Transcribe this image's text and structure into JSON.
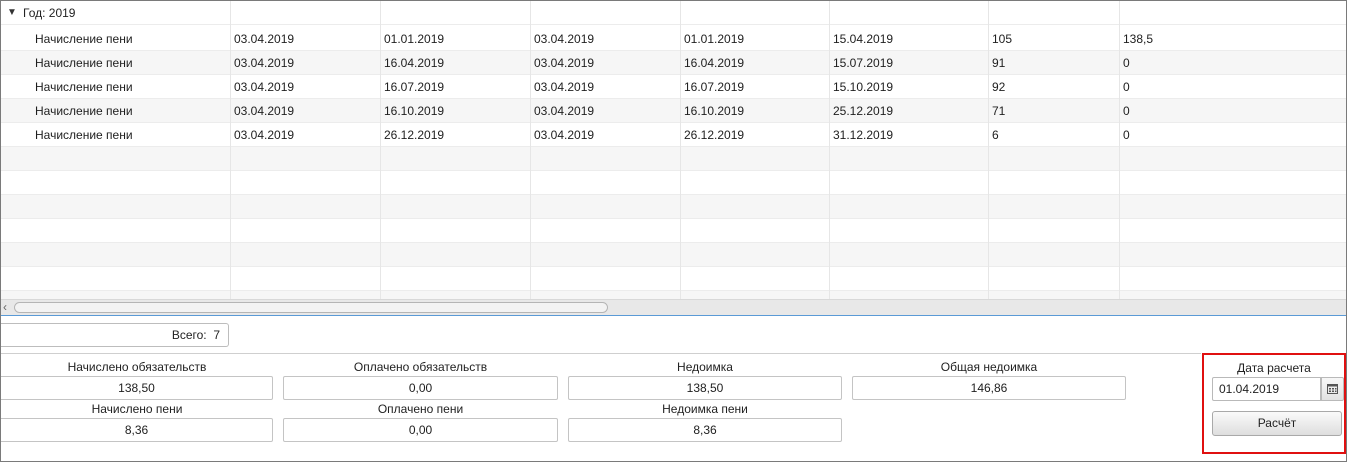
{
  "grid": {
    "group": {
      "label": "Год: 2019",
      "toggle_icon": "triangle-down-icon"
    },
    "rows": [
      [
        "Начисление пени",
        "03.04.2019",
        "01.01.2019",
        "03.04.2019",
        "01.01.2019",
        "15.04.2019",
        "105",
        "138,5"
      ],
      [
        "Начисление пени",
        "03.04.2019",
        "16.04.2019",
        "03.04.2019",
        "16.04.2019",
        "15.07.2019",
        "91",
        "0"
      ],
      [
        "Начисление пени",
        "03.04.2019",
        "16.07.2019",
        "03.04.2019",
        "16.07.2019",
        "15.10.2019",
        "92",
        "0"
      ],
      [
        "Начисление пени",
        "03.04.2019",
        "16.10.2019",
        "03.04.2019",
        "16.10.2019",
        "25.12.2019",
        "71",
        "0"
      ],
      [
        "Начисление пени",
        "03.04.2019",
        "26.12.2019",
        "03.04.2019",
        "26.12.2019",
        "31.12.2019",
        "6",
        "0"
      ]
    ]
  },
  "footer": {
    "total_label": "Всего:",
    "total_value": "7"
  },
  "summary": {
    "accrued_obligations": {
      "label": "Начислено обязательств",
      "value": "138,50"
    },
    "paid_obligations": {
      "label": "Оплачено обязательств",
      "value": "0,00"
    },
    "arrears": {
      "label": "Недоимка",
      "value": "138,50"
    },
    "total_arrears": {
      "label": "Общая недоимка",
      "value": "146,86"
    },
    "accrued_penalty": {
      "label": "Начислено пени",
      "value": "8,36"
    },
    "paid_penalty": {
      "label": "Оплачено пени",
      "value": "0,00"
    },
    "penalty_arrears": {
      "label": "Недоимка пени",
      "value": "8,36"
    }
  },
  "calculation": {
    "date_label": "Дата расчета",
    "date_value": "01.04.2019",
    "calendar_icon": "calendar-icon",
    "button_label": "Расчёт",
    "highlight_color": "#e01010"
  }
}
